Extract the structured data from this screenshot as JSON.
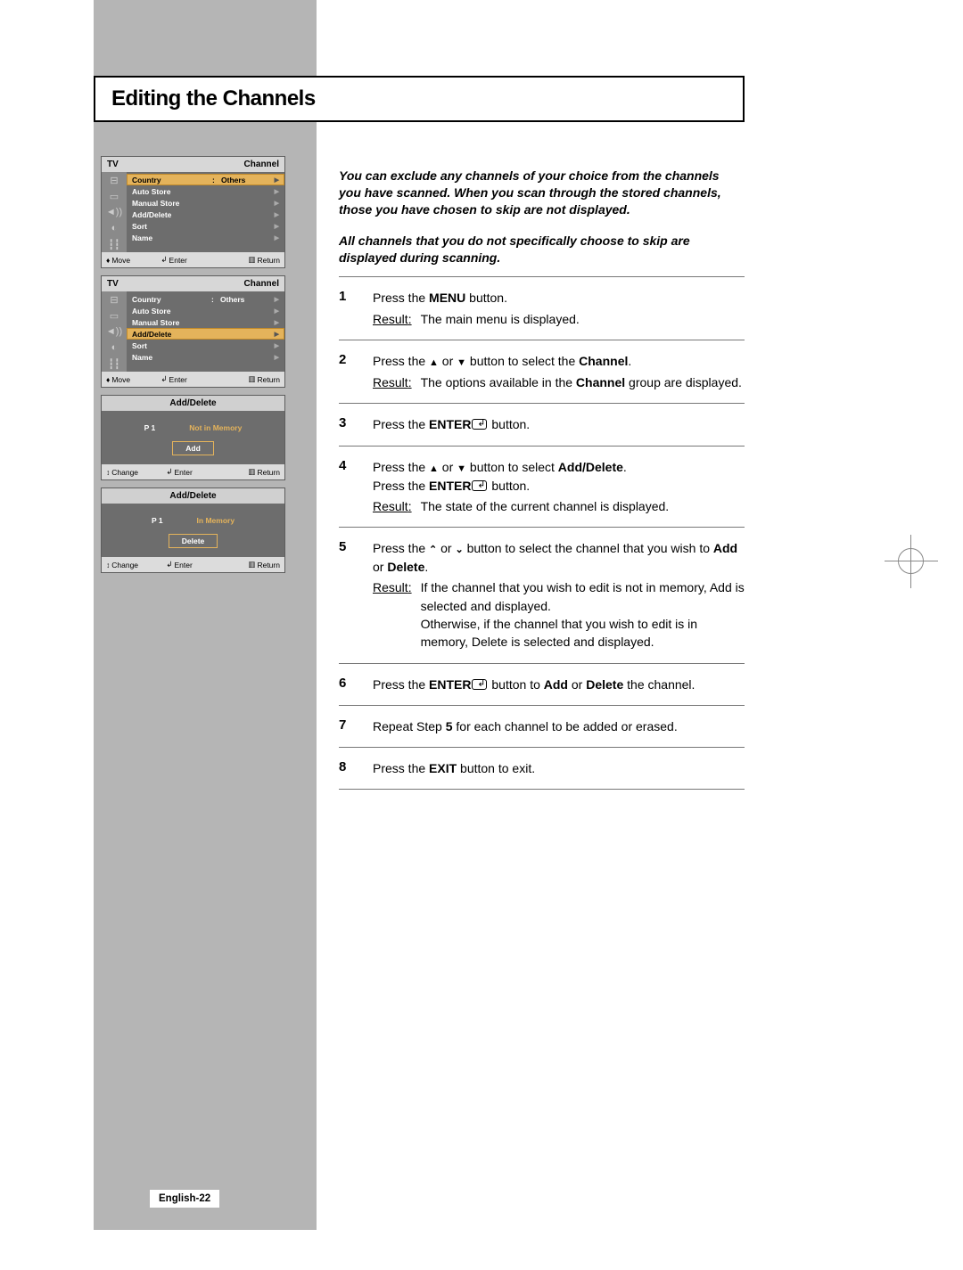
{
  "page": {
    "title": "Editing the Channels",
    "number": "English-22"
  },
  "intro": {
    "p1": "You can exclude any channels of your choice from the channels you have scanned. When you scan through the stored channels, those you have chosen to skip are not displayed.",
    "p2": "All channels that you do not specifically choose to skip are displayed during scanning."
  },
  "menuPanel": {
    "tv": "TV",
    "section": "Channel",
    "items": [
      {
        "label": "Country",
        "value": "Others"
      },
      {
        "label": "Auto Store"
      },
      {
        "label": "Manual Store"
      },
      {
        "label": "Add/Delete"
      },
      {
        "label": "Sort"
      },
      {
        "label": "Name"
      }
    ],
    "ctrl": {
      "a": "Move",
      "b": "Enter",
      "c": "Return"
    }
  },
  "panel1Highlight": 0,
  "panel2Highlight": 3,
  "addPanel1": {
    "title": "Add/Delete",
    "pnum": "P  1",
    "status": "Not in Memory",
    "button": "Add",
    "ctrl": {
      "a": "Change",
      "b": "Enter",
      "c": "Return"
    }
  },
  "addPanel2": {
    "title": "Add/Delete",
    "pnum": "P  1",
    "status": "In Memory",
    "button": "Delete",
    "ctrl": {
      "a": "Change",
      "b": "Enter",
      "c": "Return"
    }
  },
  "steps": [
    {
      "n": "1",
      "lines": [
        {
          "t": "plain",
          "text": "Press the {b}MENU{/b} button."
        },
        {
          "t": "result",
          "text": "The main menu is displayed."
        }
      ]
    },
    {
      "n": "2",
      "lines": [
        {
          "t": "plain",
          "text": "Press the ▲ or ▼ button to select the {b}Channel{/b}."
        },
        {
          "t": "result",
          "text": "The options available in the {b}Channel{/b} group are displayed."
        }
      ]
    },
    {
      "n": "3",
      "lines": [
        {
          "t": "plain",
          "text": "Press the {b}ENTER{/b}{enter} button."
        }
      ]
    },
    {
      "n": "4",
      "lines": [
        {
          "t": "plain",
          "text": "Press the ▲ or ▼ button to select {b}Add/Delete{/b}."
        },
        {
          "t": "plain",
          "text": "Press the {b}ENTER{/b}{enter} button."
        },
        {
          "t": "result",
          "text": "The state of the current channel is displayed."
        }
      ]
    },
    {
      "n": "5",
      "lines": [
        {
          "t": "plain",
          "text": "Press the ⌃ or ⌄ button to select the channel that you wish to {b}Add{/b} or {b}Delete{/b}."
        },
        {
          "t": "result",
          "text": "If the channel that you wish to edit is not in memory, Add is selected and displayed.\nOtherwise, if the channel that you wish to edit is in memory, Delete is selected and displayed."
        }
      ]
    },
    {
      "n": "6",
      "lines": [
        {
          "t": "plain",
          "text": "Press the {b}ENTER{/b}{enter} button to {b}Add{/b} or {b}Delete{/b} the channel."
        }
      ]
    },
    {
      "n": "7",
      "lines": [
        {
          "t": "plain",
          "text": "Repeat Step {b}5{/b} for each channel to be added or erased."
        }
      ]
    },
    {
      "n": "8",
      "lines": [
        {
          "t": "plain",
          "text": "Press the {b}EXIT{/b} button to exit."
        }
      ]
    }
  ],
  "resultLabel": "Result"
}
